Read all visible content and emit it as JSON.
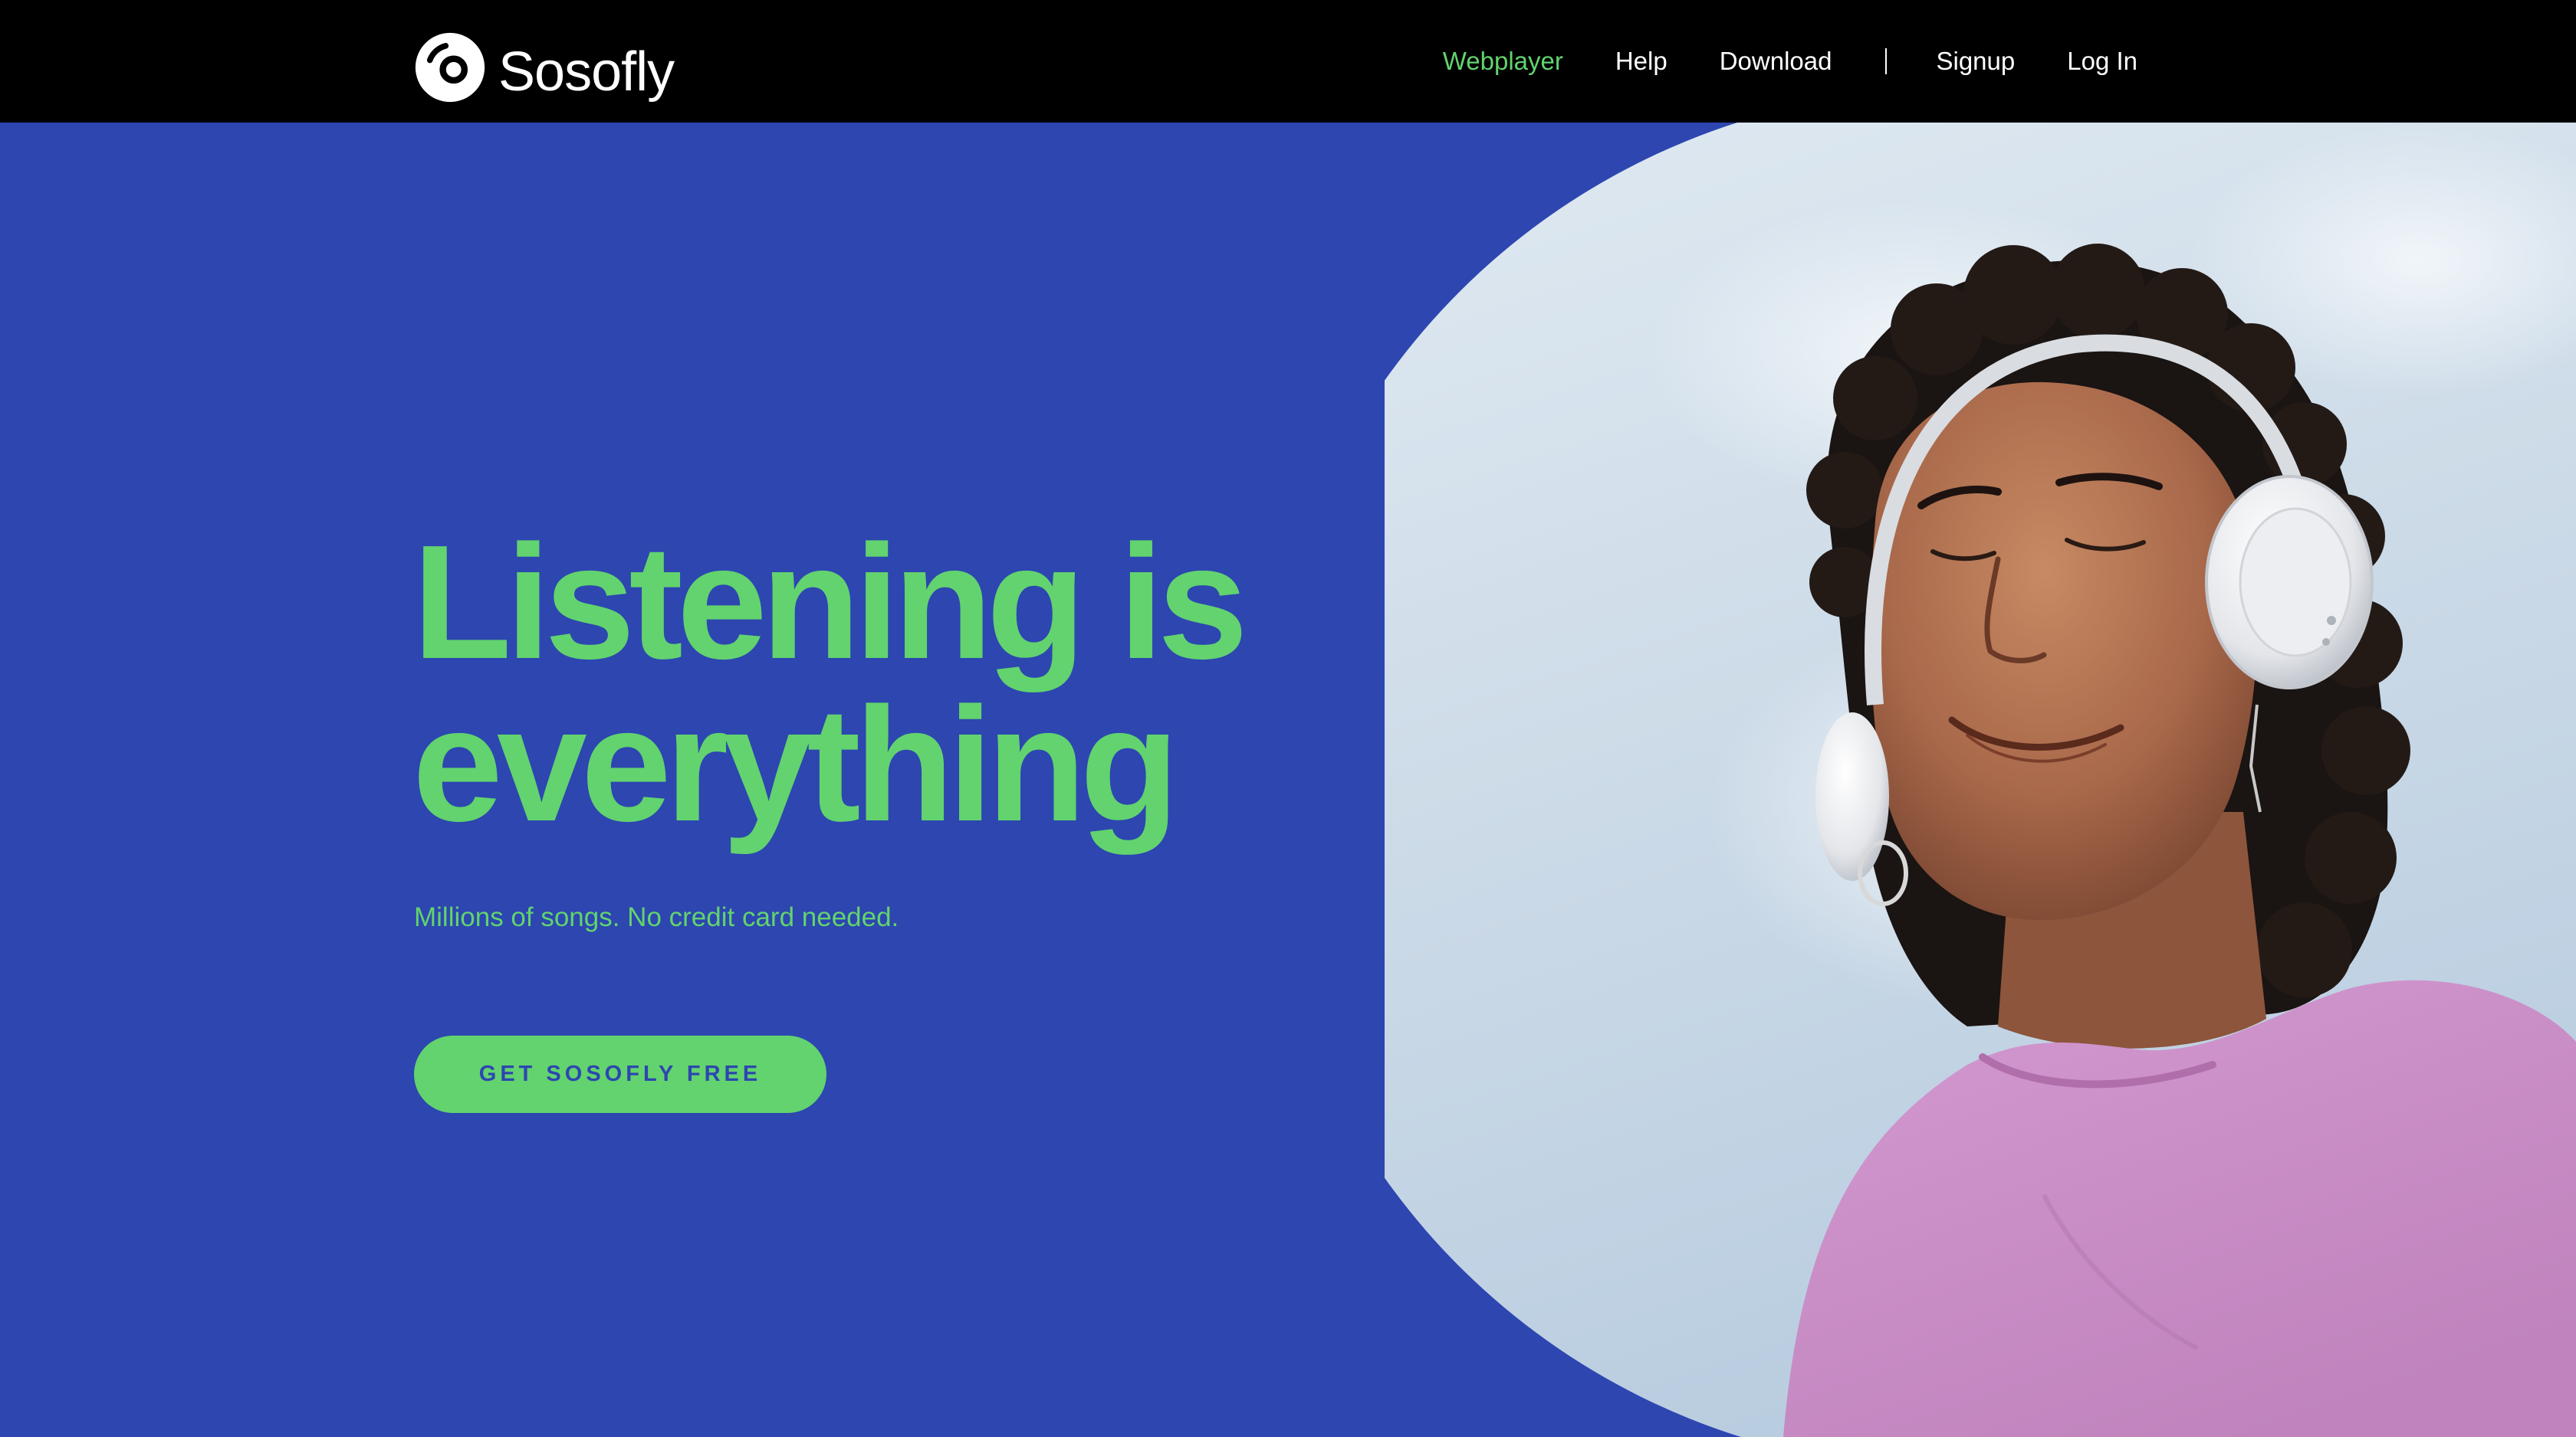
{
  "brand": {
    "name": "Sosofly",
    "logo_icon": "vinyl-disc-icon"
  },
  "nav": {
    "items": [
      {
        "label": "Webplayer",
        "active": true
      },
      {
        "label": "Help"
      },
      {
        "label": "Download"
      },
      {
        "label": "Signup"
      },
      {
        "label": "Log In"
      }
    ]
  },
  "hero": {
    "headline_line1": "Listening is",
    "headline_line2": "everything",
    "subline": "Millions of songs. No credit card needed.",
    "cta_label": "GET SOSOFLY FREE"
  },
  "colors": {
    "background": "#2d46b0",
    "accent": "#62d36e",
    "navbar": "#000000",
    "text_light": "#ffffff"
  }
}
